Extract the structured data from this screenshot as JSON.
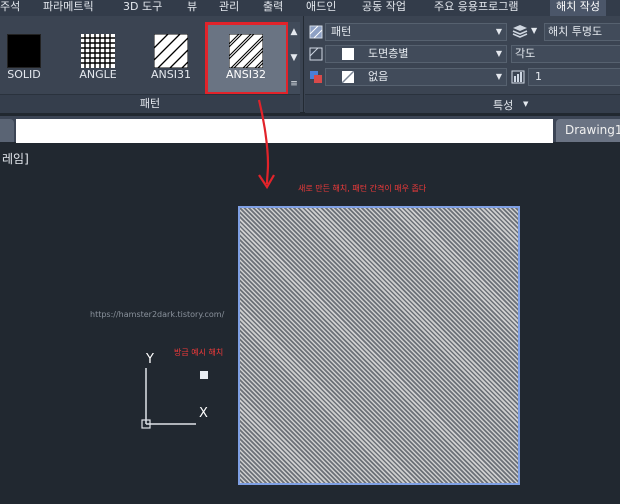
{
  "ribbon_tabs": [
    "주석",
    "파라메트릭",
    "3D 도구",
    "뷰",
    "관리",
    "출력",
    "애드인",
    "공동 작업",
    "주요 응용프로그램",
    "해치 작성"
  ],
  "active_tab": "해치 작성",
  "pattern_panel": {
    "title": "패턴",
    "patterns": [
      {
        "label": "SOLID",
        "icon": "solid-fill-icon"
      },
      {
        "label": "ANGLE",
        "icon": "angle-grid-icon"
      },
      {
        "label": "ANSI31",
        "icon": "ansi31-hatch-icon"
      },
      {
        "label": "ANSI32",
        "icon": "ansi32-hatch-icon"
      }
    ],
    "selected": "ANSI32"
  },
  "properties_panel": {
    "title": "특성",
    "hatch_type": "패턴",
    "pattern_color": "도면층별",
    "background_color": "없음",
    "transparency_label": "해치 투명도",
    "angle_label": "각도",
    "scale_value": "1"
  },
  "document_tab": "Drawing1*",
  "viewport_label": "레임]",
  "annotations": {
    "new_hatch_note": "새로 만든 해치, 패턴 간격이 매우 좁다",
    "hatch_example_note": "방금 예시 해치",
    "blog_url": "https://hamster2dark.tistory.com/"
  },
  "ucs": {
    "y_label": "Y",
    "x_label": "X"
  },
  "colors": {
    "accent_red": "#e2232a",
    "hatch_border": "#7fa0e4",
    "background": "#212830"
  }
}
